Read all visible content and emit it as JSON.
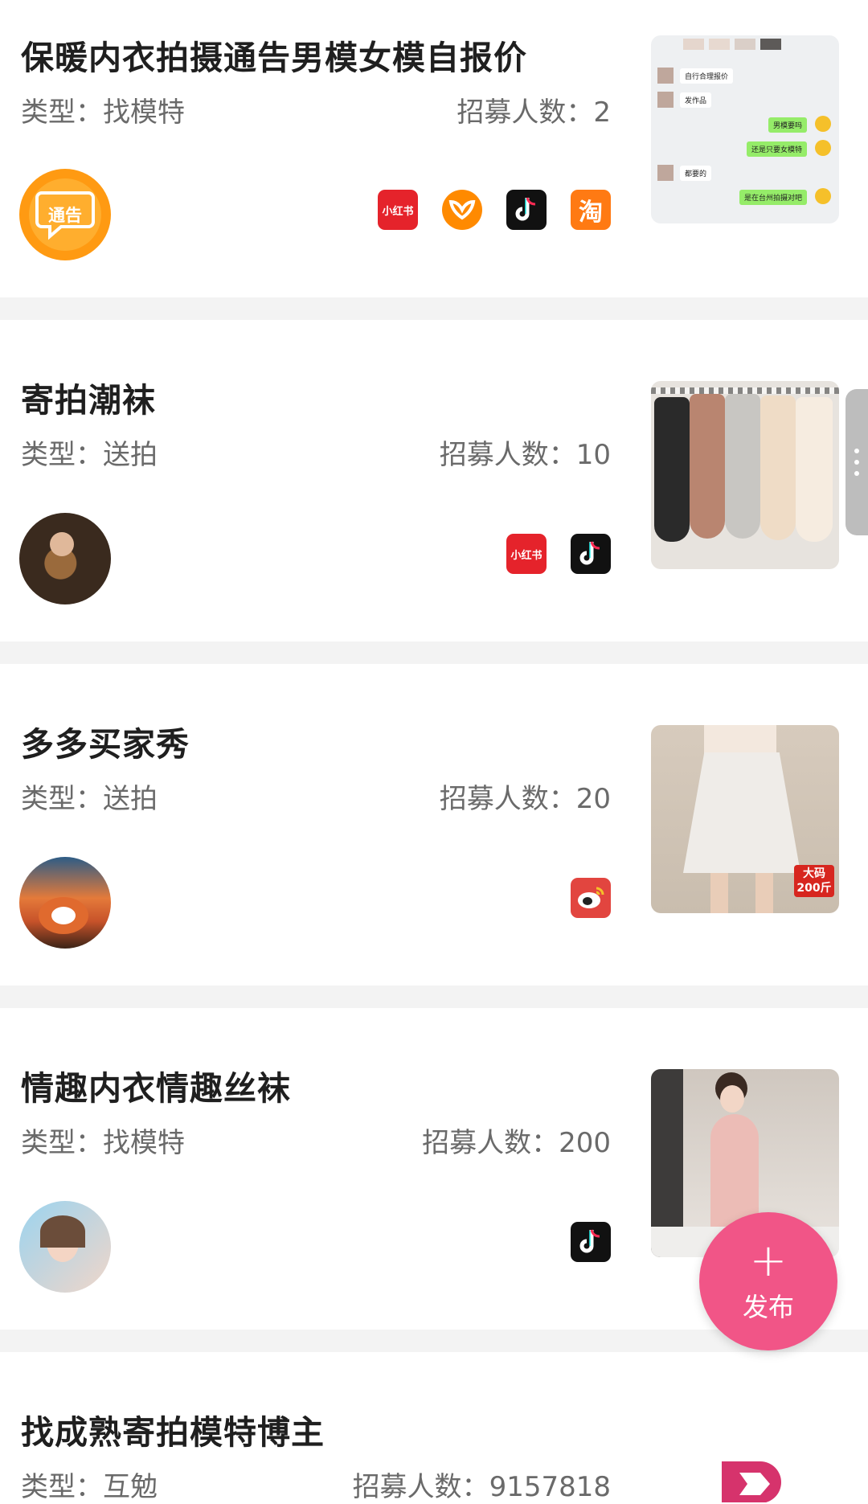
{
  "labels": {
    "type_prefix": "类型：",
    "recruit_prefix": "招募人数："
  },
  "cards": [
    {
      "title": "保暖内衣拍摄通告男模女模自报价",
      "type": "找模特",
      "recruit": "2",
      "avatar_text": "通告",
      "platforms": [
        "xiaohongshu",
        "kuaishou",
        "douyin",
        "taobao"
      ]
    },
    {
      "title": "寄拍潮袜",
      "type": "送拍",
      "recruit": "10",
      "platforms": [
        "xiaohongshu",
        "douyin"
      ]
    },
    {
      "title": "多多买家秀",
      "type": "送拍",
      "recruit": "20",
      "platforms": [
        "weibo"
      ],
      "thumb_badge": "大码\n200斤"
    },
    {
      "title": "情趣内衣情趣丝袜",
      "type": "找模特",
      "recruit": "200",
      "platforms": [
        "douyin"
      ]
    },
    {
      "title": "找成熟寄拍模特博主",
      "type": "互勉",
      "recruit": "9157818"
    }
  ],
  "chat_thumb": {
    "messages": [
      {
        "side": "left",
        "text": "自行合理报价"
      },
      {
        "side": "left",
        "text": "发作品"
      },
      {
        "side": "right",
        "text": "男模要吗"
      },
      {
        "side": "right",
        "text": "还是只要女模特"
      },
      {
        "side": "left",
        "text": "都要的"
      },
      {
        "side": "right",
        "text": "是在台州拍摄对吧"
      }
    ]
  },
  "platform_labels": {
    "xiaohongshu": "小红书",
    "taobao": "淘"
  },
  "fab": {
    "label": "发布",
    "color": "#f15587"
  },
  "colors": {
    "divider": "#f3f3f3",
    "accent": "#f15587"
  }
}
